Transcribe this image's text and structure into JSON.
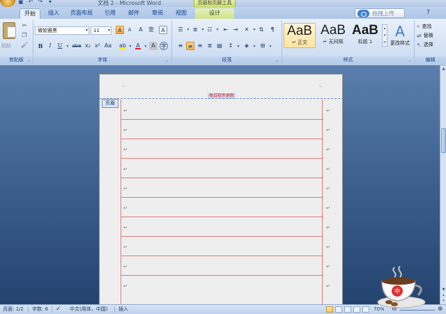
{
  "window": {
    "title": "文档 2 - Microsoft Word",
    "context_tab_title": "页眉和页脚工具"
  },
  "tabs": [
    {
      "label": "开始",
      "active": true
    },
    {
      "label": "插入"
    },
    {
      "label": "页面布局"
    },
    {
      "label": "引用"
    },
    {
      "label": "邮件"
    },
    {
      "label": "审阅"
    },
    {
      "label": "视图"
    },
    {
      "label": "设计",
      "context": true
    }
  ],
  "upload_button": {
    "label": "拖拽上传"
  },
  "ribbon": {
    "clipboard": {
      "label": "剪贴板",
      "paste_label": "粘贴"
    },
    "font": {
      "label": "字体",
      "font_name": "微软雅黑",
      "font_size": "11",
      "bold": "B",
      "italic": "I",
      "underline": "U",
      "strike": "abe",
      "subscript": "x₂",
      "superscript": "x²",
      "change_case": "Aa",
      "font_color": "A",
      "grow": "A",
      "shrink": "A",
      "clear": "A",
      "phonetic": "变",
      "char_border": "A",
      "char_shading": "A",
      "enclose": "字"
    },
    "paragraph": {
      "label": "段落"
    },
    "styles": {
      "label": "样式",
      "items": [
        {
          "sample": "AaB",
          "name": "↵ 正文",
          "selected": true
        },
        {
          "sample": "AaB",
          "name": "↵ 无间隔"
        },
        {
          "sample": "AaB",
          "name": "标题 1"
        }
      ],
      "change_styles_label": "更改样式"
    },
    "editing": {
      "label": "编辑",
      "find": "查找",
      "replace": "替换",
      "select": "选择"
    }
  },
  "document": {
    "header_tag": "页眉",
    "header_text": "每日软件更新",
    "paragraph_mark": "↵",
    "line_count": 10
  },
  "statusbar": {
    "page": "页面: 1/2",
    "words": "字数: 6",
    "language": "中文(简体，中国)",
    "mode": "插入",
    "zoom": "70%"
  },
  "mascot": {
    "cup_text": "中"
  }
}
